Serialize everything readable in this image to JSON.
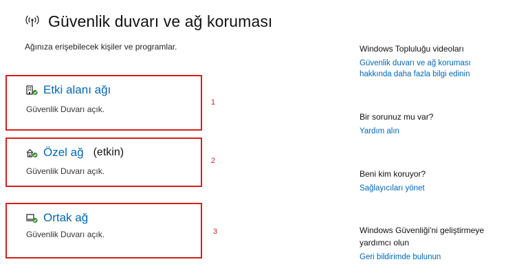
{
  "header": {
    "title": "Güvenlik duvarı ve ağ koruması",
    "title_icon": "wifi-antenna-icon",
    "subtitle": "Ağınıza erişebilecek kişiler ve programlar."
  },
  "networks": [
    {
      "name": "Etki alanı ağı",
      "active_label": "",
      "status": "Güvenlik Duvarı açık.",
      "icon": "domain-network-icon",
      "marker": "1"
    },
    {
      "name": "Özel ağ",
      "active_label": "(etkin)",
      "status": "Güvenlik Duvarı açık.",
      "icon": "private-network-icon",
      "marker": "2"
    },
    {
      "name": "Ortak ağ",
      "active_label": "",
      "status": "Güvenlik Duvarı açık.",
      "icon": "public-network-icon",
      "marker": "3"
    }
  ],
  "sidebar": {
    "sections": [
      {
        "heading": "Windows Topluluğu videoları",
        "link_line1": "Güvenlik duvarı ve ağ koruması",
        "link_line2": "hakkında daha fazla bilgi edinin"
      },
      {
        "heading": "Bir sorunuz mu var?",
        "link": "Yardım alın"
      },
      {
        "heading": "Beni kim koruyor?",
        "link": "Sağlayıcıları yönet"
      },
      {
        "heading_line1": "Windows Güvenliği'ni geliştirmeye",
        "heading_line2": "yardımcı olun",
        "link": "Geri bildirimde bulunun"
      }
    ]
  },
  "colors": {
    "link": "#0067b8",
    "highlight_border": "#d21f1f",
    "status_ok": "#2f8f2f"
  }
}
